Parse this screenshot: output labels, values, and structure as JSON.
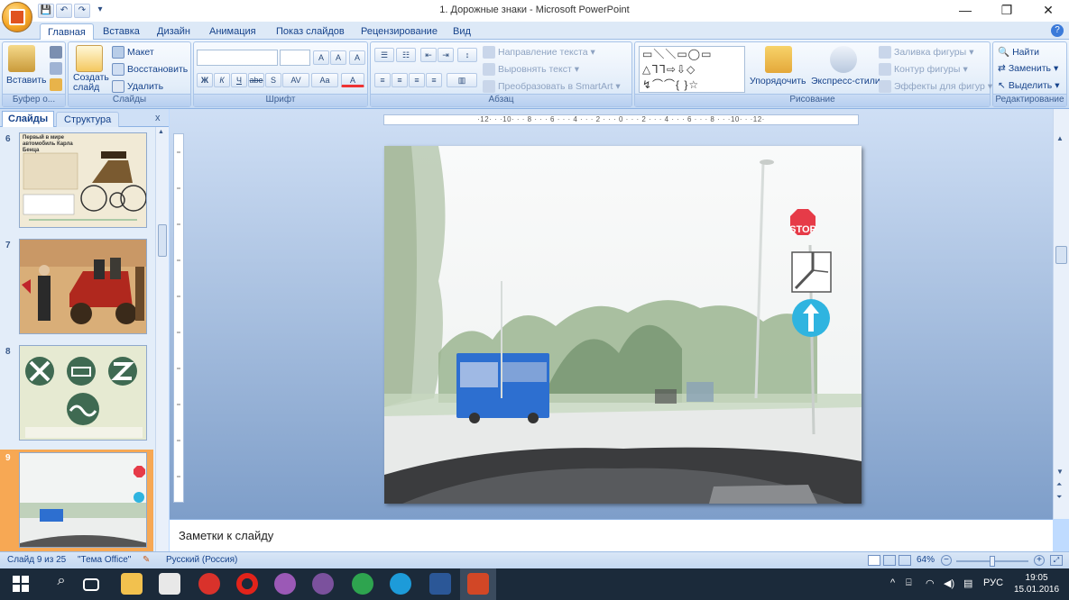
{
  "window": {
    "title": "1. Дорожные знаки - Microsoft PowerPoint",
    "controls": {
      "minimize": "—",
      "restore": "❐",
      "close": "✕"
    }
  },
  "quick_access": {
    "save": "💾",
    "undo": "↶",
    "redo": "↷",
    "more": "▾"
  },
  "tabs": [
    "Главная",
    "Вставка",
    "Дизайн",
    "Анимация",
    "Показ слайдов",
    "Рецензирование",
    "Вид"
  ],
  "active_tab": "Главная",
  "ribbon": {
    "clipboard": {
      "label": "Буфер о...",
      "paste": "Вставить"
    },
    "slides": {
      "label": "Слайды",
      "create": "Создать слайд",
      "layout": "Макет",
      "reset": "Восстановить",
      "delete": "Удалить"
    },
    "font": {
      "label": "Шрифт",
      "bold": "Ж",
      "italic": "К",
      "underline": "Ч",
      "strike": "abe",
      "shadow": "S",
      "spacing": "AV",
      "case": "Aa",
      "grow": "A",
      "shrink": "A",
      "clear": "A",
      "color": "A"
    },
    "paragraph": {
      "label": "Абзац",
      "text_direction": "Направление текста",
      "align_text": "Выровнять текст",
      "smartart": "Преобразовать в SmartArt"
    },
    "drawing": {
      "label": "Рисование",
      "arrange": "Упорядочить",
      "quick_styles": "Экспресс-стили",
      "fill": "Заливка фигуры",
      "outline": "Контур фигуры",
      "effects": "Эффекты для фигур",
      "shapes_row1": "▭＼＼▭◯▭",
      "shapes_row2": "△ᒣᒣ⇨⇩◇",
      "shapes_row3": "↯⌒⌒{ }☆"
    },
    "editing": {
      "label": "Редактирование",
      "find": "Найти",
      "replace": "Заменить",
      "select": "Выделить"
    }
  },
  "left_panel": {
    "tab_slides": "Слайды",
    "tab_outline": "Структура",
    "close": "x",
    "thumbnails": [
      {
        "number": "6",
        "title": "Первый в мире автомобиль Карла Бенца"
      },
      {
        "number": "7",
        "title": ""
      },
      {
        "number": "8",
        "title": ""
      },
      {
        "number": "9",
        "title": ""
      }
    ],
    "selected": "9"
  },
  "ruler": {
    "horizontal": "·12· · ·10· · · 8 · · · 6 · · · 4 · · · 2 · · · 0 · · · 2 · · · 4 · · · 6 · · · 8 · · ·10· · ·12·"
  },
  "slide": {
    "stop_sign": "STOP"
  },
  "notes": {
    "placeholder": "Заметки к слайду"
  },
  "status": {
    "slide_info": "Слайд 9 из 25",
    "theme": "\"Тема Office\"",
    "language": "Русский (Россия)",
    "zoom": "64%",
    "zoom_value": 0.64
  },
  "taskbar": {
    "tray_lang": "РУС",
    "time": "19:05",
    "date": "15.01.2016"
  },
  "colors": {
    "ribbon_text": "#15428b",
    "selected_thumb": "#f7a854",
    "taskbar": "#1b2a3a",
    "stop_red": "#e63b48",
    "sign_blue": "#2fb4e0"
  }
}
